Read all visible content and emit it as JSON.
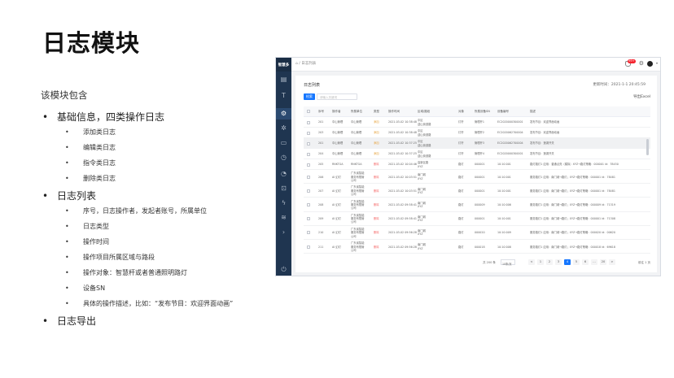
{
  "slide": {
    "title": "日志模块",
    "intro": "该模块包含",
    "sections": [
      {
        "label": "基础信息，四类操作日志",
        "items": [
          "添加类日志",
          "编辑类日志",
          "指令类日志",
          "删除类日志"
        ]
      },
      {
        "label": "日志列表",
        "items": [
          "序号，日志操作者，发起者账号，所属单位",
          "日志类型",
          "操作时间",
          "操作项目所属区域与路段",
          "操作对象：智慧杆或者普通照明路灯",
          "设备SN",
          "具体的操作描述，比如：“发布节目：欢迎界面动画”"
        ]
      },
      {
        "label": "日志导出",
        "items": []
      }
    ]
  },
  "app": {
    "logo": "智慧多",
    "breadcrumb": "⌂ / 日志列表",
    "badge": "99+",
    "panel_title": "日志列表",
    "refresh": "更新时间：2021-1-1 20:45:59",
    "search_label": "检索",
    "search_placeholder": "请输入关键词",
    "export_label": "导出Excel",
    "columns": [
      "",
      "序号",
      "操作者",
      "所属单位",
      "类型",
      "操作时间",
      "区域/路段",
      "对象",
      "所属设备SN",
      "设备编号",
      "描述"
    ],
    "rows": [
      [
        "",
        "201",
        "中山管理",
        "中山管理",
        "添加",
        "2021-03-02 10:38:48",
        "中区\n迎山街道路",
        "灯杆",
        "管理杆1",
        "EC2020000300001",
        "发布节目：欢迎界面动画"
      ],
      [
        "",
        "203",
        "中山管理",
        "中山管理",
        "添加",
        "2021-03-02 10:38:48",
        "中区\n迎山街道路",
        "灯杆",
        "管理杆2",
        "EC2020062700004",
        "发布节目：欢迎界面动画"
      ],
      [
        "",
        "201",
        "中山管理",
        "中山管理",
        "添加",
        "2021-03-02 10:37:25",
        "中区\n迎山街道路",
        "灯杆",
        "管理杆3",
        "EC2020062700004",
        "发布节目：莲湖开关"
      ],
      [
        "",
        "204",
        "中山管理",
        "中山管理",
        "添加",
        "2021-03-02 10:37:25",
        "中区\n迎山街道路",
        "灯杆",
        "管理杆4",
        "EC2020000300001",
        "发布节目：莲湖开关"
      ],
      [
        "",
        "205",
        "RNKTGA",
        "RNKTGA",
        "删除",
        "2021-03-02 10:04:46",
        "高新区路\nXYZ",
        "路灯",
        "000001",
        "10:10:001",
        "路灯路灯1 应用：普通点亮（模拟）XYZ→路灯策略：000001 id：78450"
      ],
      [
        "",
        "206",
        "AI 幻灯",
        "广东省智能\n服务有限管\n公司",
        "删除",
        "2021-03-02 10:03:51",
        "南门城\nXYZ",
        "路灯",
        "000001",
        "10:10:001",
        "服务路灯1 应用：南门城→路灯；XYZ→路灯策略：000001 id：78481"
      ],
      [
        "",
        "207",
        "AI 幻灯",
        "广东省智能\n服务有限管\n公司",
        "删除",
        "2021-03-02 10:03:51",
        "南门城\nXYZ",
        "路灯",
        "000001",
        "10:10:001",
        "服务路灯1 应用：南门城→路灯；XYZ→路灯策略：000001 id：78481"
      ],
      [
        "",
        "208",
        "AI 幻灯",
        "广东省智能\n服务有限管\n公司",
        "删除",
        "2021-03-02 09:58:41",
        "南门城\nXYZ",
        "路灯",
        "000009",
        "10:10:006",
        "服务路灯1 应用：南门城→路灯；XYZ→路灯策略：000009 id：71319"
      ],
      [
        "",
        "209",
        "AI 幻灯",
        "广东省智能\n服务有限管\n公司",
        "删除",
        "2021-03-02 09:58:41",
        "南门城\nXYZ",
        "路灯",
        "000001",
        "10:10:001",
        "服务路灯1 应用：南门城→路灯；XYZ→路灯策略：000001 id：71308"
      ],
      [
        "",
        "210",
        "AI 幻灯",
        "广东省智能\n服务有限管\n公司",
        "删除",
        "2021-03-02 09:56:28",
        "南门城\nXYZ",
        "路灯",
        "000020",
        "10:10:009",
        "服务路灯1 应用：南门城→路灯；XYZ→路灯策略：000020 id：00620"
      ],
      [
        "",
        "211",
        "AI 幻灯",
        "广东省智能\n服务有限管\n公司",
        "删除",
        "2021-03-02 09:56:28",
        "南门城\nXYZ",
        "路灯",
        "000018",
        "10:10:008",
        "服务路灯1 应用：南门城→路灯；XYZ→路灯策略：000018 id：69618"
      ]
    ],
    "pager": {
      "total": "共 200 条",
      "size": "10条/页",
      "prev": "<",
      "pages": [
        "1",
        "2",
        "3",
        "4",
        "5",
        "6",
        "…",
        "20"
      ],
      "active": "4",
      "next": ">",
      "goto": "前往  1  页"
    }
  }
}
